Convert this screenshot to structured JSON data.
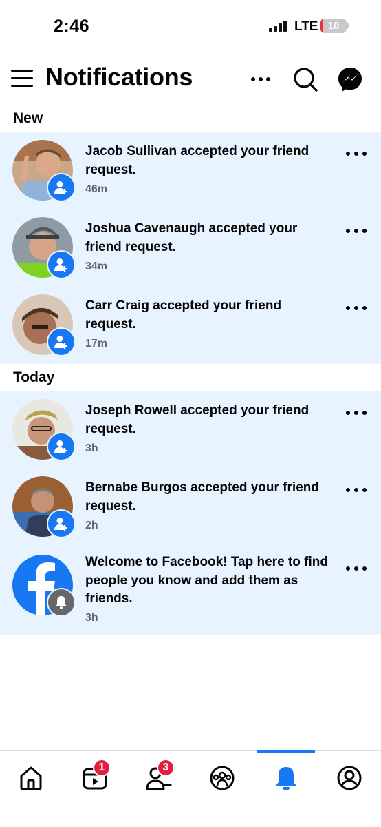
{
  "status_bar": {
    "time": "2:46",
    "network": "LTE",
    "battery_level": "10",
    "battery_fraction": 0.1,
    "battery_color": "#e5383b"
  },
  "header": {
    "title": "Notifications",
    "icons": [
      "menu-icon",
      "more-icon",
      "search-icon",
      "messenger-icon"
    ]
  },
  "colors": {
    "accent": "#1877f2",
    "unread_bg": "#e7f3ff",
    "badge_red": "#e41e3f",
    "meta_gray": "#65676b"
  },
  "sections": [
    {
      "title": "New",
      "items": [
        {
          "name": "Jacob Sullivan",
          "action": " accepted your friend request.",
          "time": "46m",
          "badge": "add-friend-icon"
        },
        {
          "name": "Joshua Cavenaugh",
          "action": " accepted your friend request.",
          "time": "34m",
          "badge": "add-friend-icon"
        },
        {
          "name": "Carr Craig",
          "action": " accepted your friend request.",
          "time": "17m",
          "badge": "add-friend-icon"
        }
      ]
    },
    {
      "title": "Today",
      "items": [
        {
          "name": "Joseph Rowell",
          "action": " accepted your friend request.",
          "time": "3h",
          "badge": "add-friend-icon"
        },
        {
          "name": "Bernabe Burgos",
          "action": " accepted your friend request.",
          "time": "2h",
          "badge": "add-friend-icon"
        },
        {
          "name": "",
          "action": "Welcome to Facebook! Tap here to find people you know and add them as friends.",
          "time": "3h",
          "badge": "bell-icon"
        }
      ]
    }
  ],
  "bottom_nav": {
    "items": [
      {
        "icon": "home-icon",
        "badge": ""
      },
      {
        "icon": "video-icon",
        "badge": "1"
      },
      {
        "icon": "friends-icon",
        "badge": "3"
      },
      {
        "icon": "groups-icon",
        "badge": ""
      },
      {
        "icon": "notifications-icon",
        "badge": "",
        "active": true
      },
      {
        "icon": "profile-icon",
        "badge": ""
      }
    ]
  }
}
